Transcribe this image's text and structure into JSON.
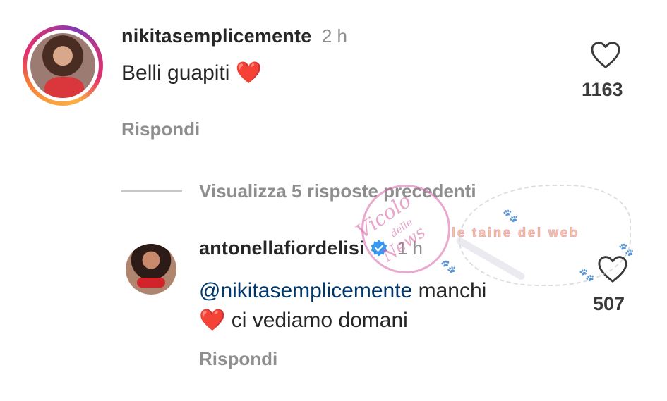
{
  "comment_1": {
    "username": "nikitasemplicemente",
    "time": "2 h",
    "text": "Belli guapiti ❤️",
    "likes": "1163",
    "reply_label": "Rispondi"
  },
  "replies_toggle": {
    "label": "Visualizza 5 risposte precedenti"
  },
  "comment_2": {
    "username": "antonellafiordelisi",
    "verified": true,
    "time": "1 h",
    "mention": "@nikitasemplicemente",
    "text_line1": " manchi",
    "text_line2": "❤️ ci vediamo domani",
    "likes": "507",
    "reply_label": "Rispondi"
  },
  "watermark": {
    "script_text": "Vicolo",
    "script_small": "delle",
    "script_text2": "News",
    "banner_text": "le taine del web"
  },
  "colors": {
    "text": "#262626",
    "secondary": "#8e8e8e",
    "mention": "#00376b",
    "heart": "#ed4956",
    "verified": "#3897f0"
  },
  "icons": {
    "like": "heart-outline-icon",
    "verified": "verified-badge-icon"
  }
}
